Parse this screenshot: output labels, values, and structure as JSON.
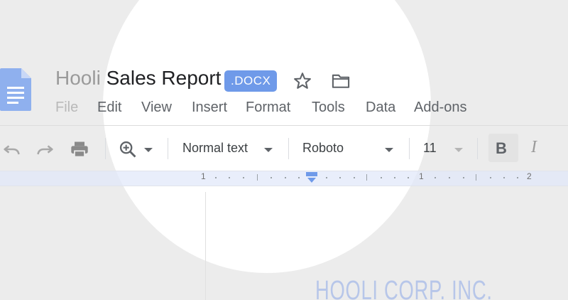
{
  "document": {
    "title_prefix": "Hooli",
    "title_main": "Sales Report",
    "badge": ".DOCX"
  },
  "icons": {
    "app": "docs-file-icon",
    "star": "star-outline-icon",
    "folder": "folder-icon",
    "undo": "undo-icon",
    "redo": "redo-icon",
    "print": "print-icon",
    "zoom": "zoom-in-icon"
  },
  "menu": [
    "File",
    "Edit",
    "View",
    "Insert",
    "Format",
    "Tools",
    "Data",
    "Add-ons"
  ],
  "toolbar": {
    "style": "Normal text",
    "font": "Roboto",
    "size": "11",
    "bold": "B",
    "italic": "I"
  },
  "ruler": {
    "labels": [
      "1",
      "1",
      "2"
    ]
  },
  "page": {
    "heading": "HOOLI CORP. INC."
  },
  "colors": {
    "accent": "#6f9ae9",
    "corp_text": "#b7c6e9"
  }
}
